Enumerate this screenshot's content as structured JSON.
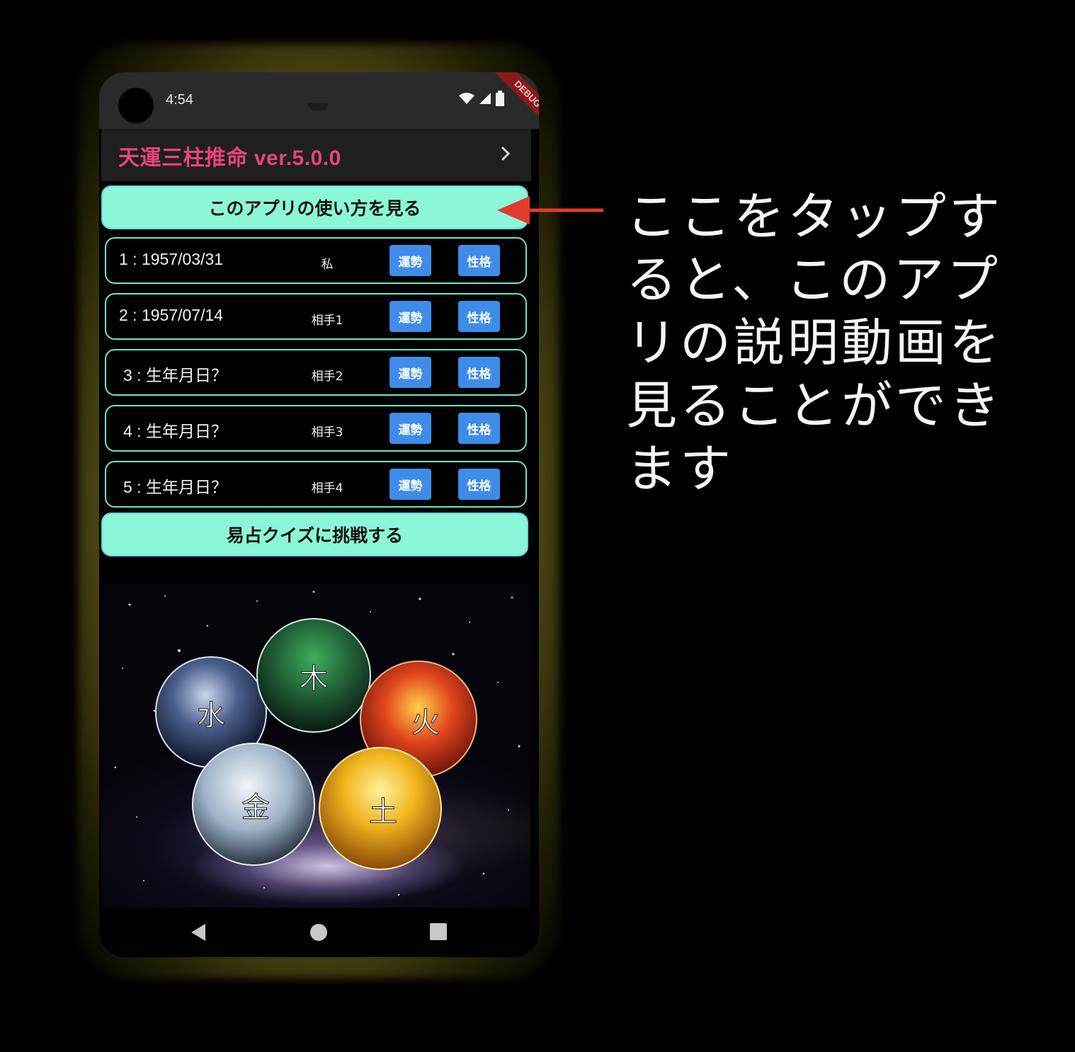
{
  "status_bar": {
    "time": "4:54",
    "debug_label": "DEBUG",
    "icons": [
      "wifi-icon",
      "signal-icon",
      "battery-icon"
    ]
  },
  "app_bar": {
    "title": "天運三柱推命 ver.5.0.0",
    "title_color": "#e8457a",
    "action_icon": "chevron-right-icon"
  },
  "how_to_button": {
    "label": "このアプリの使い方を見る"
  },
  "people": [
    {
      "label": "1 : 1957/03/31",
      "who": "私",
      "fortune_label": "運勢",
      "personality_label": "性格"
    },
    {
      "label": "2 : 1957/07/14",
      "who": "相手1",
      "fortune_label": "運勢",
      "personality_label": "性格"
    },
    {
      "label": "3 : 生年月日？",
      "who": "相手2",
      "fortune_label": "運勢",
      "personality_label": "性格"
    },
    {
      "label": "4 : 生年月日？",
      "who": "相手3",
      "fortune_label": "運勢",
      "personality_label": "性格"
    },
    {
      "label": "5 : 生年月日？",
      "who": "相手4",
      "fortune_label": "運勢",
      "personality_label": "性格"
    }
  ],
  "quiz_button": {
    "label": "易占クイズに挑戦する"
  },
  "elements": {
    "water": "水",
    "wood": "木",
    "fire": "火",
    "metal": "金",
    "earth": "土"
  },
  "nav_bar": {
    "icons": [
      "back-icon",
      "home-icon",
      "recents-icon"
    ]
  },
  "annotation": {
    "lines": [
      "ここをタップす",
      "ると、このアプ",
      "リの説明動画を",
      "見ることができ",
      "ます"
    ],
    "arrow_color": "#e33a2c"
  },
  "colors": {
    "accent_button": "#8cf6d9",
    "chip_blue": "#3f8ce8",
    "row_border": "#6fe4c6"
  }
}
